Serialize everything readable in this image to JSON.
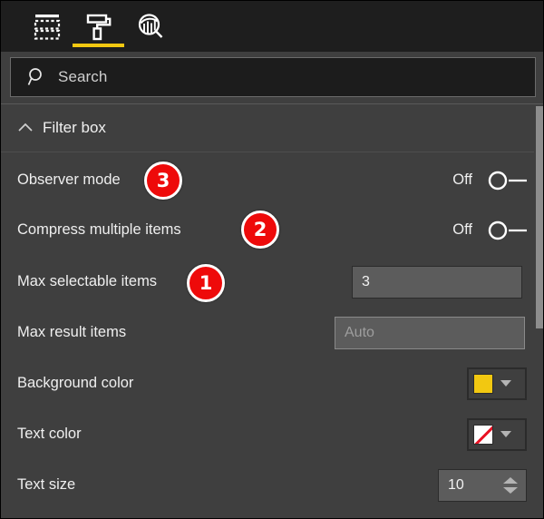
{
  "toolbar": {
    "items": [
      {
        "name": "fields-pane",
        "icon": "table-fields-icon",
        "active": false
      },
      {
        "name": "format-pane",
        "icon": "paint-roller-icon",
        "active": true
      },
      {
        "name": "analytics-pane",
        "icon": "analytics-magnifier-icon",
        "active": false
      }
    ],
    "active_accent": "#f2c811"
  },
  "search": {
    "placeholder": "Search",
    "value": "",
    "icon": "search-icon"
  },
  "section": {
    "title": "Filter box",
    "expanded": true,
    "chevron": "chevron-up-icon"
  },
  "rows": [
    {
      "label": "Observer mode",
      "control": "toggle",
      "state": "Off",
      "badge": "3"
    },
    {
      "label": "Compress multiple items",
      "control": "toggle",
      "state": "Off",
      "badge": "2"
    },
    {
      "label": "Max selectable items",
      "control": "textfield",
      "value": "3",
      "badge": "1"
    },
    {
      "label": "Max result items",
      "control": "textfield",
      "placeholder": "Auto",
      "value": ""
    },
    {
      "label": "Background color",
      "control": "colorpicker",
      "swatch_color": "#f2c811",
      "swatch_kind": "solid"
    },
    {
      "label": "Text color",
      "control": "colorpicker",
      "swatch_color": "#ffffff",
      "swatch_kind": "none",
      "slash_color": "#e81123"
    },
    {
      "label": "Text size",
      "control": "spinner",
      "value": "10"
    }
  ],
  "badge_color": "#ee0a0a",
  "scrollbar": {
    "present": true
  }
}
